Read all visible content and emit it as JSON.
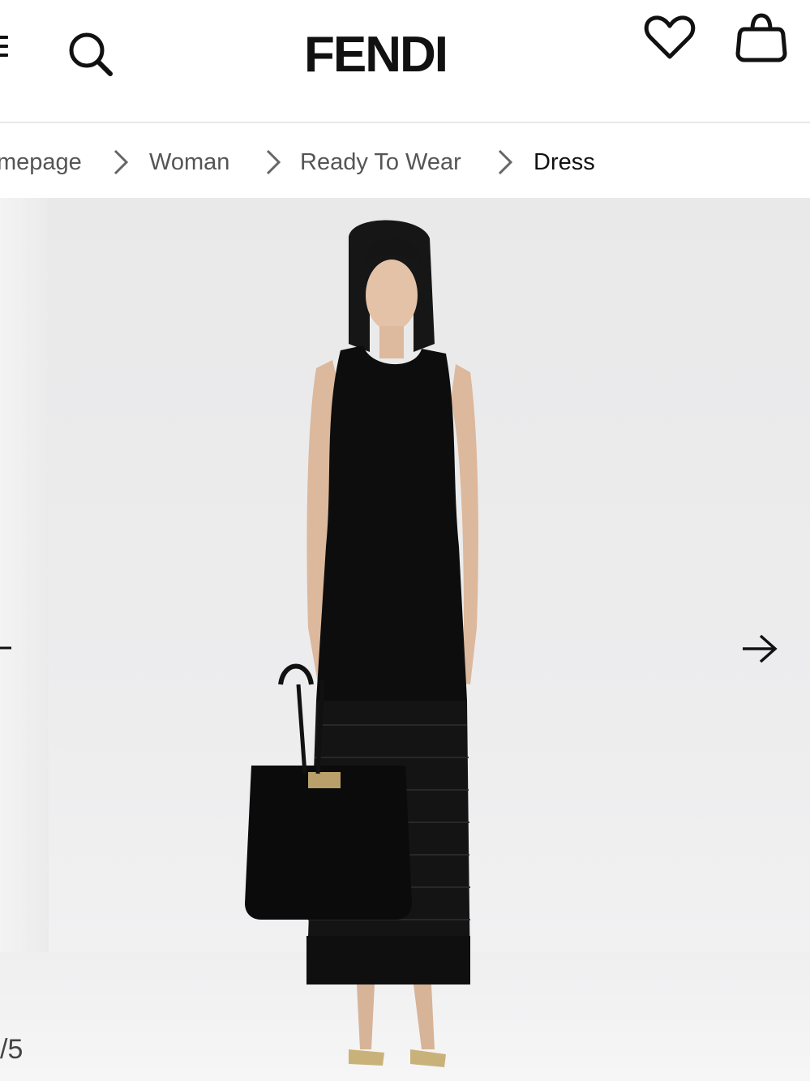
{
  "header": {
    "logo": "FENDI",
    "icons": [
      "menu-icon",
      "search-icon",
      "heart-icon",
      "bag-icon"
    ]
  },
  "breadcrumb": {
    "items": [
      "mepage",
      "Woman",
      "Ready To Wear",
      "Dress"
    ]
  },
  "gallery": {
    "image_alt": "Model wearing black sleeveless knit maxi dress holding black handbag",
    "counter": "/5",
    "icons": [
      "arrow-left-icon",
      "arrow-right-icon"
    ]
  },
  "colors": {
    "text": "#111111",
    "muted": "#555555",
    "background": "#ffffff",
    "gallery_bg": "#ececed"
  }
}
